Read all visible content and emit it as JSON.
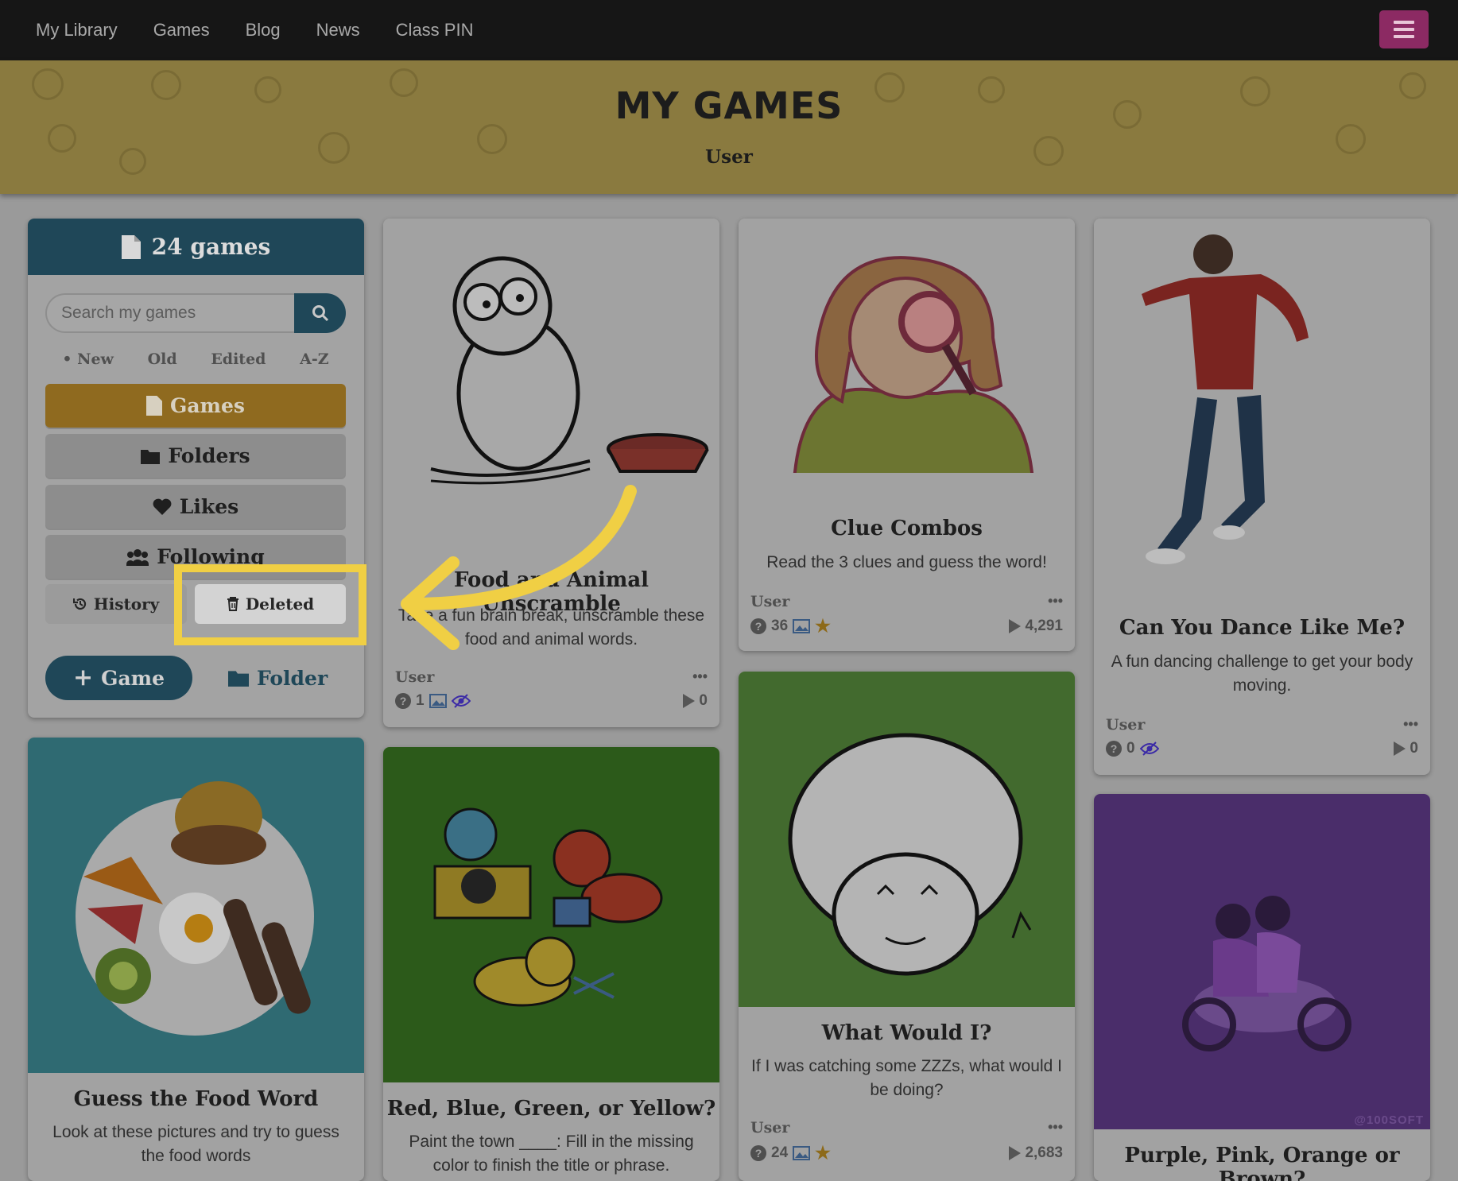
{
  "nav": {
    "items": [
      "My Library",
      "Games",
      "Blog",
      "News",
      "Class PIN"
    ]
  },
  "banner": {
    "title": "MY GAMES",
    "subtitle": "User"
  },
  "sidebar": {
    "count_label": "24 games",
    "search_placeholder": "Search my games",
    "sort": [
      "• New",
      "Old",
      "Edited",
      "A-Z"
    ],
    "nav": {
      "games": "Games",
      "folders": "Folders",
      "likes": "Likes",
      "following": "Following"
    },
    "history": "History",
    "deleted": "Deleted",
    "add_game": "Game",
    "add_folder": "Folder"
  },
  "cards": [
    {
      "title": "Food and Animal Unscramble",
      "desc": "Take a fun brain break, unscramble these food and animal words.",
      "user": "User",
      "questions": "1",
      "plays": "0"
    },
    {
      "title": "Clue Combos",
      "desc": "Read the 3 clues and guess the word!",
      "user": "User",
      "questions": "36",
      "plays": "4,291"
    },
    {
      "title": "Can You Dance Like Me?",
      "desc": "A fun dancing challenge to get your body moving.",
      "user": "User",
      "questions": "0",
      "plays": "0"
    },
    {
      "title": "What Would I?",
      "desc": "If I was catching some ZZZs, what would I be doing?",
      "user": "User",
      "questions": "24",
      "plays": "2,683"
    },
    {
      "title": "Guess the Food Word",
      "desc": "Look at these pictures and try to guess the food words"
    },
    {
      "title": "Red, Blue, Green, or Yellow?",
      "desc": "Paint the town ____: Fill in the missing color to finish the title or phrase."
    },
    {
      "title": "Purple, Pink, Orange or Brown?",
      "watermark": "@100SOFT"
    }
  ],
  "more_label": "•••",
  "colors": {
    "accent": "#f0cf44",
    "brand": "#1f4758",
    "active": "#8f6a1f"
  }
}
